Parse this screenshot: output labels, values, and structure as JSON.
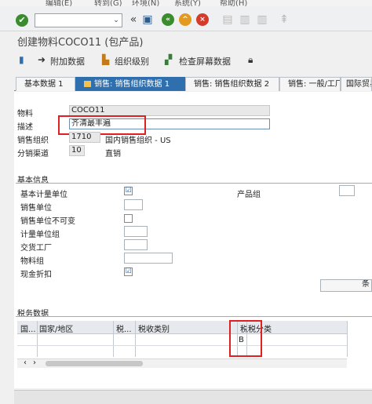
{
  "menu": [
    "编辑(E)",
    "转到(G)",
    "环境(N)",
    "系统(Y)",
    "帮助(H)"
  ],
  "toolbar": {
    "ok": "✔",
    "cmd_placeholder": ""
  },
  "title": "创建物料COCO11 (包产品)",
  "app_toolbar": {
    "additional_data": "附加数据",
    "org_levels": "组织级别",
    "check_screen": "检查屏幕数据"
  },
  "tabs": [
    "基本数据 1",
    "销售: 销售组织数据 1",
    "销售: 销售组织数据 2",
    "销售: 一般/工厂",
    "国际贸易"
  ],
  "header": {
    "material_label": "物料",
    "material_value": "COCO11",
    "desc_label": "描述",
    "desc_value": "齐清最丰遍",
    "salesorg_label": "销售组织",
    "salesorg_value": "1710",
    "salesorg_text": "国内销售组织 - US",
    "channel_label": "分销渠道",
    "channel_value": "10",
    "channel_text": "直销"
  },
  "basic": {
    "title": "基本信息",
    "base_uom": "基本计量单位",
    "product_group": "产品组",
    "sales_unit": "销售单位",
    "sales_unit_fixed": "销售单位不可变",
    "uom_group": "计量单位组",
    "delivery_plant": "交货工厂",
    "material_group": "物料组",
    "cash_discount": "现金折扣",
    "cond_button": "条"
  },
  "tax": {
    "title": "税务数据",
    "columns": [
      "国...",
      "国家/地区",
      "税...",
      "税收类别",
      "税",
      "税分类"
    ],
    "row_value": "B"
  }
}
